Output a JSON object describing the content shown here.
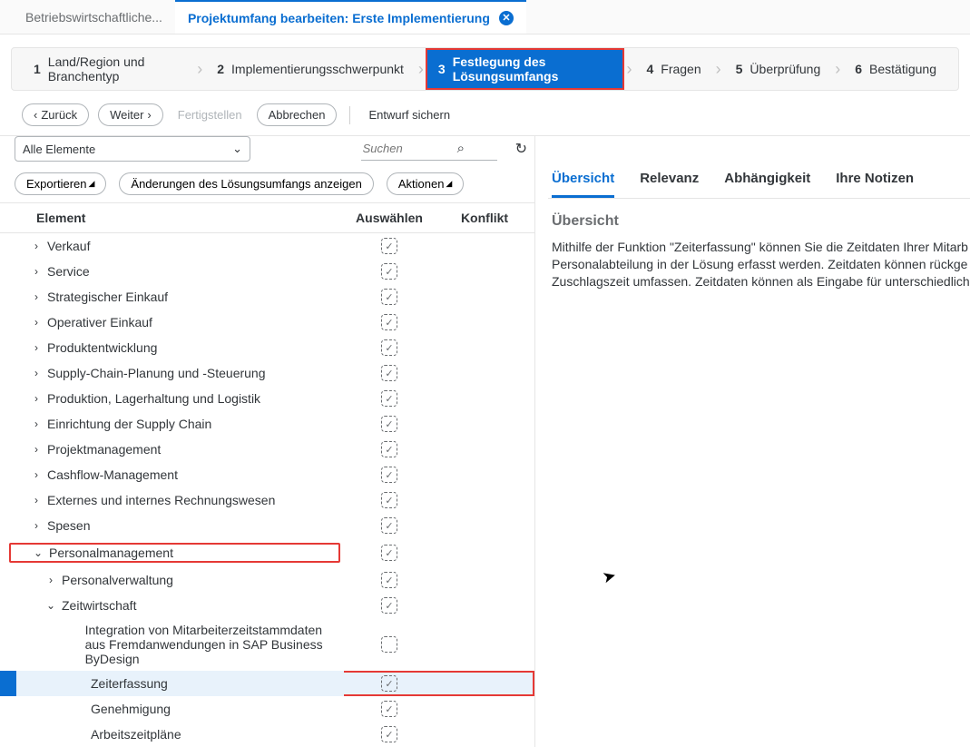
{
  "topTabs": {
    "inactive": "Betriebswirtschaftliche...",
    "active": "Projektumfang bearbeiten: Erste Implementierung"
  },
  "wizard": [
    {
      "num": "1",
      "label": "Land/Region und Branchentyp",
      "active": false
    },
    {
      "num": "2",
      "label": "Implementierungsschwerpunkt",
      "active": false
    },
    {
      "num": "3",
      "label": "Festlegung des Lösungsumfangs",
      "active": true,
      "hl": true
    },
    {
      "num": "4",
      "label": "Fragen",
      "active": false
    },
    {
      "num": "5",
      "label": "Überprüfung",
      "active": false
    },
    {
      "num": "6",
      "label": "Bestätigung",
      "active": false
    }
  ],
  "toolbar": {
    "back": "Zurück",
    "next": "Weiter",
    "finish": "Fertigstellen",
    "cancel": "Abbrechen",
    "save_draft": "Entwurf sichern"
  },
  "filter": {
    "dropdown": "Alle Elemente",
    "search_placeholder": "Suchen"
  },
  "actions": {
    "export": "Exportieren",
    "show_changes": "Änderungen des Lösungsumfangs anzeigen",
    "actions": "Aktionen"
  },
  "columns": {
    "element": "Element",
    "select": "Auswählen",
    "conflict": "Konflikt"
  },
  "rows": [
    {
      "label": "Verkauf",
      "indent": 0,
      "exp": "closed",
      "check": "checked"
    },
    {
      "label": "Service",
      "indent": 0,
      "exp": "closed",
      "check": "checked"
    },
    {
      "label": "Strategischer Einkauf",
      "indent": 0,
      "exp": "closed",
      "check": "checked"
    },
    {
      "label": "Operativer Einkauf",
      "indent": 0,
      "exp": "closed",
      "check": "checked"
    },
    {
      "label": "Produktentwicklung",
      "indent": 0,
      "exp": "closed",
      "check": "checked"
    },
    {
      "label": "Supply-Chain-Planung und -Steuerung",
      "indent": 0,
      "exp": "closed",
      "check": "checked"
    },
    {
      "label": "Produktion, Lagerhaltung und Logistik",
      "indent": 0,
      "exp": "closed",
      "check": "checked"
    },
    {
      "label": "Einrichtung der Supply Chain",
      "indent": 0,
      "exp": "closed",
      "check": "checked"
    },
    {
      "label": "Projektmanagement",
      "indent": 0,
      "exp": "closed",
      "check": "checked"
    },
    {
      "label": "Cashflow-Management",
      "indent": 0,
      "exp": "closed",
      "check": "checked"
    },
    {
      "label": "Externes und internes Rechnungswesen",
      "indent": 0,
      "exp": "closed",
      "check": "checked"
    },
    {
      "label": "Spesen",
      "indent": 0,
      "exp": "closed",
      "check": "checked"
    },
    {
      "label": "Personalmanagement",
      "indent": 0,
      "exp": "open",
      "check": "checked",
      "hl": true
    },
    {
      "label": "Personalverwaltung",
      "indent": 1,
      "exp": "closed",
      "check": "checked"
    },
    {
      "label": "Zeitwirtschaft",
      "indent": 1,
      "exp": "open",
      "check": "checked"
    },
    {
      "label": "Integration von Mitarbeiterzeitstammdaten aus Fremdanwendungen in SAP Business ByDesign",
      "indent": 2,
      "exp": "none",
      "check": "empty"
    },
    {
      "label": "Zeiterfassung",
      "indent": 2,
      "exp": "none",
      "check": "checked",
      "sel": true,
      "fullhl": true
    },
    {
      "label": "Genehmigung",
      "indent": 2,
      "exp": "none",
      "check": "checked"
    },
    {
      "label": "Arbeitszeitpläne",
      "indent": 2,
      "exp": "none",
      "check": "checked"
    }
  ],
  "detail": {
    "tabs": [
      "Übersicht",
      "Relevanz",
      "Abhängigkeit",
      "Ihre Notizen"
    ],
    "active_tab": 0,
    "section": "Übersicht",
    "text": "Mithilfe der Funktion \"Zeiterfassung\" können Sie die Zeitdaten Ihrer Mitarb Personalabteilung in der Lösung erfasst werden. Zeitdaten können rückge Zuschlagszeit umfassen. Zeitdaten können als Eingabe für unterschiedlich"
  }
}
